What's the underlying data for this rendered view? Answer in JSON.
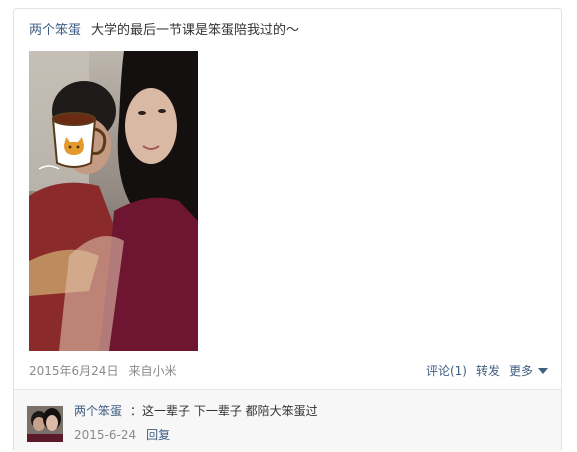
{
  "post": {
    "author": "两个笨蛋",
    "text": "大学的最后一节课是笨蛋陪我过的～",
    "photo_icon": "photo",
    "cup_sticker_icon": "coffee-cup-sticker"
  },
  "meta": {
    "date": "2015年6月24日",
    "source": "来自小米"
  },
  "actions": {
    "comment": "评论(1)",
    "repost": "转发",
    "more": "更多"
  },
  "comments": [
    {
      "author": "两个笨蛋",
      "text": "：这一辈子 下一辈子 都陪大笨蛋过",
      "date": "2015-6-24",
      "reply": "回复",
      "avatar_icon": "avatar-photo"
    }
  ],
  "colors": {
    "link": "#3f5e82",
    "meta": "#8a8a8a",
    "comment_bg": "#f7f7f7"
  }
}
